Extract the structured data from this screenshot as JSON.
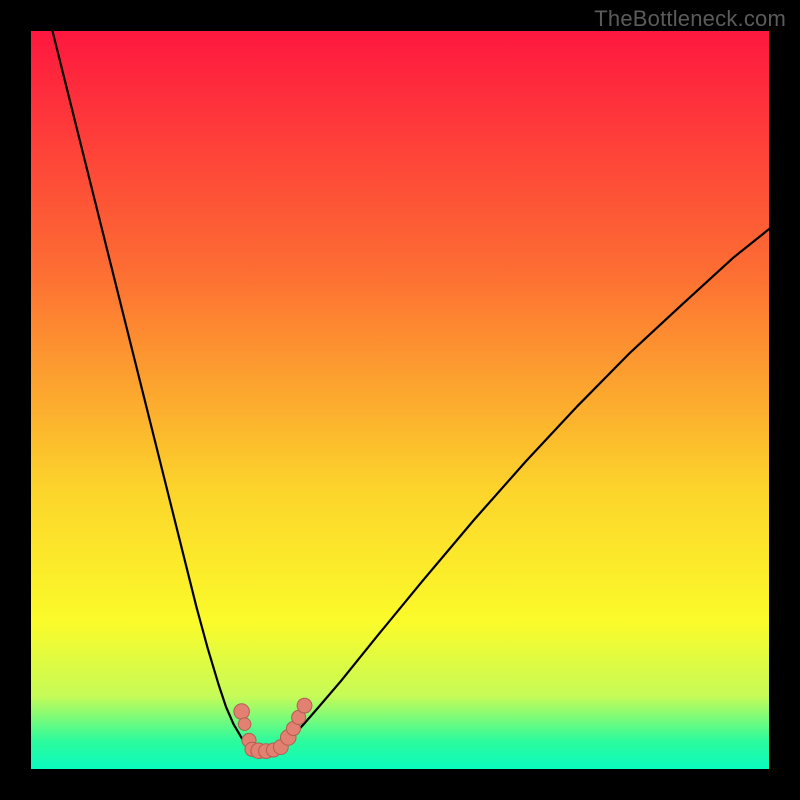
{
  "watermark": "TheBottleneck.com",
  "colors": {
    "gradient_top": "#fe173f",
    "gradient_mid1": "#fd6c33",
    "gradient_mid2": "#fcd42b",
    "gradient_mid3": "#fbfb2a",
    "gradient_bottom1": "#c6fb57",
    "gradient_bottom2": "#2efb9c",
    "gradient_bottom3": "#08fbc0",
    "marker_fill": "#e28071",
    "marker_stroke": "#b35d52",
    "curve_stroke": "#000000",
    "frame_stroke": "#000000"
  },
  "layout": {
    "image_size": 800,
    "plot_inset": 30,
    "gradient_green_start_frac": 0.89
  },
  "chart_data": {
    "type": "line",
    "title": "",
    "xlabel": "",
    "ylabel": "",
    "xlim": [
      0,
      100
    ],
    "ylim": [
      0,
      100
    ],
    "series": [
      {
        "name": "left-curve",
        "x": [
          3,
          5,
          7,
          9,
          11,
          13,
          15,
          17,
          19,
          21,
          22.5,
          24,
          25.5,
          26.5,
          27.5,
          28.5,
          29.1,
          29.8
        ],
        "y": [
          100,
          92,
          84,
          76,
          68,
          60,
          52,
          44,
          36,
          28,
          22,
          16.5,
          11.5,
          8.5,
          6.2,
          4.5,
          3.5,
          2.8
        ]
      },
      {
        "name": "right-curve",
        "x": [
          33.5,
          34.5,
          35.5,
          37,
          39,
          42,
          47,
          53,
          60,
          67,
          74,
          81,
          88,
          95,
          100
        ],
        "y": [
          2.8,
          3.6,
          4.6,
          6.2,
          8.5,
          12,
          18.2,
          25.5,
          33.8,
          41.7,
          49.2,
          56.3,
          62.8,
          69.2,
          73.2
        ]
      },
      {
        "name": "valley-floor",
        "x": [
          29.8,
          30.6,
          31.4,
          32.2,
          33.5
        ],
        "y": [
          2.8,
          2.6,
          2.55,
          2.6,
          2.8
        ]
      }
    ],
    "markers": [
      {
        "x": 28.6,
        "y": 7.9,
        "r": 1.05
      },
      {
        "x": 29.0,
        "y": 6.2,
        "r": 0.85
      },
      {
        "x": 29.6,
        "y": 4.0,
        "r": 0.95
      },
      {
        "x": 30.0,
        "y": 2.8,
        "r": 0.95
      },
      {
        "x": 30.9,
        "y": 2.6,
        "r": 1.05
      },
      {
        "x": 31.9,
        "y": 2.55,
        "r": 1.0
      },
      {
        "x": 32.9,
        "y": 2.7,
        "r": 0.95
      },
      {
        "x": 33.9,
        "y": 3.1,
        "r": 1.0
      },
      {
        "x": 34.9,
        "y": 4.4,
        "r": 1.05
      },
      {
        "x": 35.6,
        "y": 5.6,
        "r": 0.95
      },
      {
        "x": 36.3,
        "y": 7.1,
        "r": 0.95
      },
      {
        "x": 37.1,
        "y": 8.7,
        "r": 1.0
      }
    ]
  }
}
